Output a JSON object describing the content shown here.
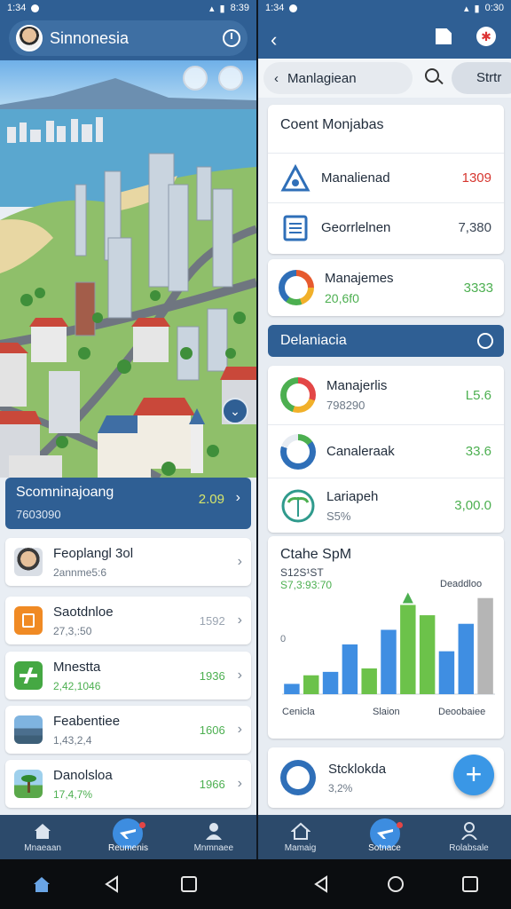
{
  "left": {
    "status": {
      "time": "1:34",
      "clock": "8:39"
    },
    "header": {
      "title": "Sinnonesia"
    },
    "banner": {
      "title": "Scomninajoang",
      "subtitle": "7603090",
      "value": "2.09"
    },
    "list": [
      {
        "title": "Feoplangl 3ol",
        "subtitle": "2annme5:6",
        "value": "",
        "icon": "person-photo-icon"
      },
      {
        "title": "Saotdnloe",
        "subtitle": "27,3,:50",
        "value": "1592",
        "icon": "orange-doc-icon"
      },
      {
        "title": "Mnestta",
        "subtitle": "2,42,1046",
        "value": "1936",
        "icon": "green-plane-icon"
      },
      {
        "title": "Feabentiee",
        "subtitle": "1,43,2,4",
        "value": "1606",
        "icon": "city-thumb-icon"
      },
      {
        "title": "Danolsloa",
        "subtitle": "17,4,7%",
        "value": "1966",
        "icon": "palm-thumb-icon"
      }
    ],
    "nav": [
      {
        "label": "Mnaeaan",
        "icon": "home-icon"
      },
      {
        "label": "Reumenis",
        "icon": "plane-icon"
      },
      {
        "label": "Mnmnaee",
        "icon": "person-icon"
      }
    ]
  },
  "right": {
    "status": {
      "time": "1:34",
      "clock": "0:30"
    },
    "search": {
      "value": "Manlagiean",
      "stat": "Strtr"
    },
    "content": {
      "title": "Coent Monjabas",
      "rows": [
        {
          "label": "Manalienad",
          "value": "1309",
          "icon": "triangle-icon",
          "color": "#d6362f"
        },
        {
          "label": "Georrlelnen",
          "value": "7,380",
          "icon": "document-icon",
          "color": "#3c4756"
        }
      ]
    },
    "manajemes": {
      "title": "Manajemes",
      "subtitle": "20,6f0",
      "value": "3333"
    },
    "section": {
      "title": "Delaniacia"
    },
    "stats": [
      {
        "label": "Manajerlis",
        "subtitle": "798290",
        "value": "L5.6",
        "icon": "multicolor-ring-icon"
      },
      {
        "label": "Canaleraak",
        "subtitle": "",
        "value": "33.6",
        "icon": "progress-ring-icon"
      },
      {
        "label": "Lariapeh",
        "subtitle": "S5%",
        "value": "3,00.0",
        "icon": "palm-logo-icon"
      }
    ],
    "chart": {
      "title": "Ctahe SpM",
      "subtitle": "S12S¹ST",
      "subtitle2": "S7,3:93:70",
      "top_right": "Deaddloo",
      "y_tick": "0",
      "x_labels": [
        "Cenicla",
        "Slaion",
        "Deoobaiee"
      ]
    },
    "chart_data": {
      "type": "bar",
      "categories": [
        "1",
        "2",
        "3",
        "4",
        "5",
        "6",
        "7",
        "8",
        "9",
        "10",
        "11"
      ],
      "values": [
        12,
        22,
        26,
        58,
        30,
        75,
        104,
        92,
        50,
        82,
        112
      ],
      "colors": [
        "#3f8ee2",
        "#6cc24a",
        "#3f8ee2",
        "#3f8ee2",
        "#6cc24a",
        "#3f8ee2",
        "#6cc24a",
        "#6cc24a",
        "#3f8ee2",
        "#3f8ee2",
        "#b5b5b5"
      ],
      "ylim": [
        0,
        120
      ]
    },
    "bottom_card": {
      "title": "Stcklokda",
      "subtitle": "3,2%"
    },
    "nav": [
      {
        "label": "Mamaig",
        "icon": "home-icon"
      },
      {
        "label": "Sotnace",
        "icon": "plane-icon"
      },
      {
        "label": "Rolabsale",
        "icon": "person-icon"
      }
    ]
  },
  "colors": {
    "primary": "#2f5f94",
    "green": "#4caf50",
    "red": "#d6362f",
    "accent": "#3a97e6"
  }
}
